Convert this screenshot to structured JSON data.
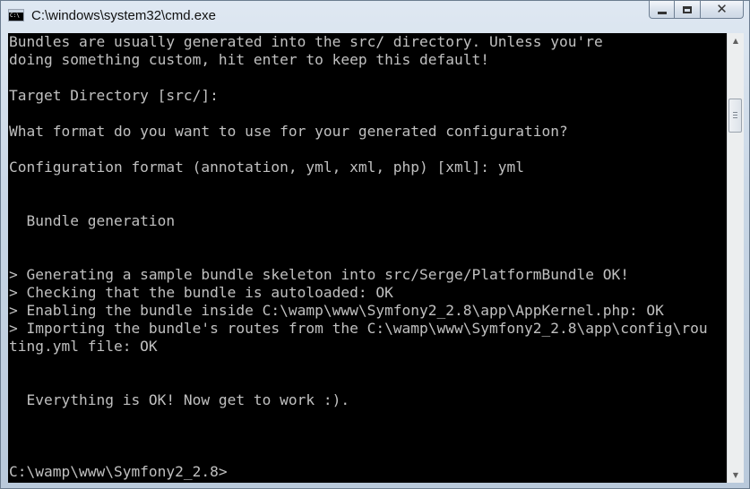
{
  "window": {
    "title": "C:\\windows\\system32\\cmd.exe",
    "controls": {
      "minimize": "minimize",
      "maximize": "maximize",
      "close": "close"
    }
  },
  "console": {
    "text_color": "#c0c0c0",
    "background": "#000000",
    "lines": [
      "Bundles are usually generated into the src/ directory. Unless you're",
      "doing something custom, hit enter to keep this default!",
      "",
      "Target Directory [src/]:",
      "",
      "What format do you want to use for your generated configuration?",
      "",
      "Configuration format (annotation, yml, xml, php) [xml]: yml",
      "",
      "",
      "  Bundle generation",
      "",
      "",
      "> Generating a sample bundle skeleton into src/Serge/PlatformBundle OK!",
      "> Checking that the bundle is autoloaded: OK",
      "> Enabling the bundle inside C:\\wamp\\www\\Symfony2_2.8\\app\\AppKernel.php: OK",
      "> Importing the bundle's routes from the C:\\wamp\\www\\Symfony2_2.8\\app\\config\\rou",
      "ting.yml file: OK",
      "",
      "",
      "  Everything is OK! Now get to work :).",
      "",
      "",
      "",
      "C:\\wamp\\www\\Symfony2_2.8>"
    ]
  },
  "scrollbar": {
    "up_arrow": "scroll-up-arrow-icon",
    "down_arrow": "scroll-down-arrow-icon"
  }
}
